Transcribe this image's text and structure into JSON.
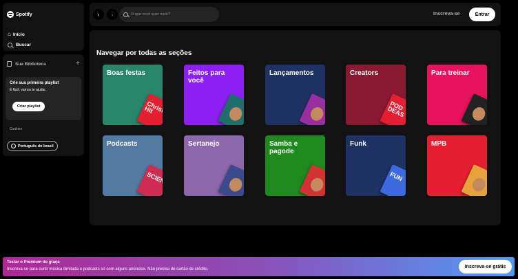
{
  "app": {
    "name": "Spotify"
  },
  "nav": {
    "home": "Início",
    "search": "Buscar"
  },
  "library": {
    "title": "Sua Biblioteca",
    "promo_title": "Crie sua primeira playlist",
    "promo_sub": "É fácil, vamos te ajudar.",
    "promo_button": "Criar playlist",
    "cookies": "Cookies",
    "language": "Português do brasil"
  },
  "topbar": {
    "search_placeholder": "O que você quer ouvir?",
    "signup": "Inscreva-se",
    "login": "Entrar"
  },
  "main": {
    "section_title": "Navegar por todas as seções",
    "cards": [
      {
        "label": "Boas festas",
        "color": "#27856a",
        "art_color": "#e61e32",
        "art_text": "Christ Hit"
      },
      {
        "label": "Feitos para você",
        "color": "#8d1ff2",
        "art_color": "#1e6e6e",
        "art_text": ""
      },
      {
        "label": "Lançamentos",
        "color": "#1e3264",
        "art_color": "#9b2e9e",
        "art_text": ""
      },
      {
        "label": "Creators",
        "color": "#8c1932",
        "art_color": "#e61e32",
        "art_text": "POD DEAS"
      },
      {
        "label": "Para treinar",
        "color": "#e8115b",
        "art_color": "#222222",
        "art_text": ""
      },
      {
        "label": "Podcasts",
        "color": "#537aa1",
        "art_color": "#d02c51",
        "art_text": "SCIENCE"
      },
      {
        "label": "Sertanejo",
        "color": "#8d67ab",
        "art_color": "#3a4a8c",
        "art_text": ""
      },
      {
        "label": "Samba e pagode",
        "color": "#1e8a1e",
        "art_color": "#d23232",
        "art_text": ""
      },
      {
        "label": "Funk",
        "color": "#1e3264",
        "art_color": "#3d6ae0",
        "art_text": "FUN"
      },
      {
        "label": "MPB",
        "color": "#e61e32",
        "art_color": "#e8a23a",
        "art_text": ""
      }
    ]
  },
  "premium": {
    "title": "Testar o Premium de graça",
    "subtitle": "Inscreva-se para curtir música ilimitada e podcasts só com alguns anúncios. Não precisa de cartão de crédito.",
    "button": "Inscreva-se grátis"
  }
}
